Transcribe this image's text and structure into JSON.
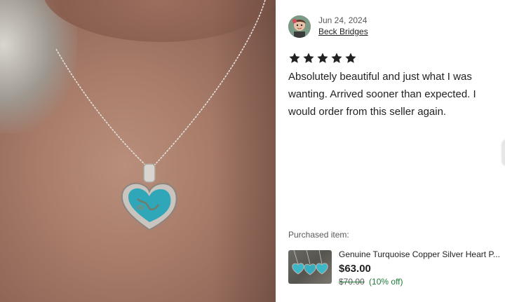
{
  "photo": {
    "alt_icon": "turquoise-heart-pendant-photo"
  },
  "review": {
    "date": "Jun 24, 2024",
    "reviewer_name": "Beck Bridges",
    "rating": 5,
    "rating_max": 5,
    "text": "Absolutely beautiful and just what I was wanting. Arrived sooner than expected. I would order from this seller again."
  },
  "purchased": {
    "label": "Purchased item:",
    "title": "Genuine Turquoise Copper Silver Heart P...",
    "price": "$63.00",
    "original_price": "$70.00",
    "discount": "(10% off)"
  },
  "colors": {
    "star": "#222222",
    "discount_green": "#1f7a3a",
    "turquoise": "#2fa7b8"
  }
}
